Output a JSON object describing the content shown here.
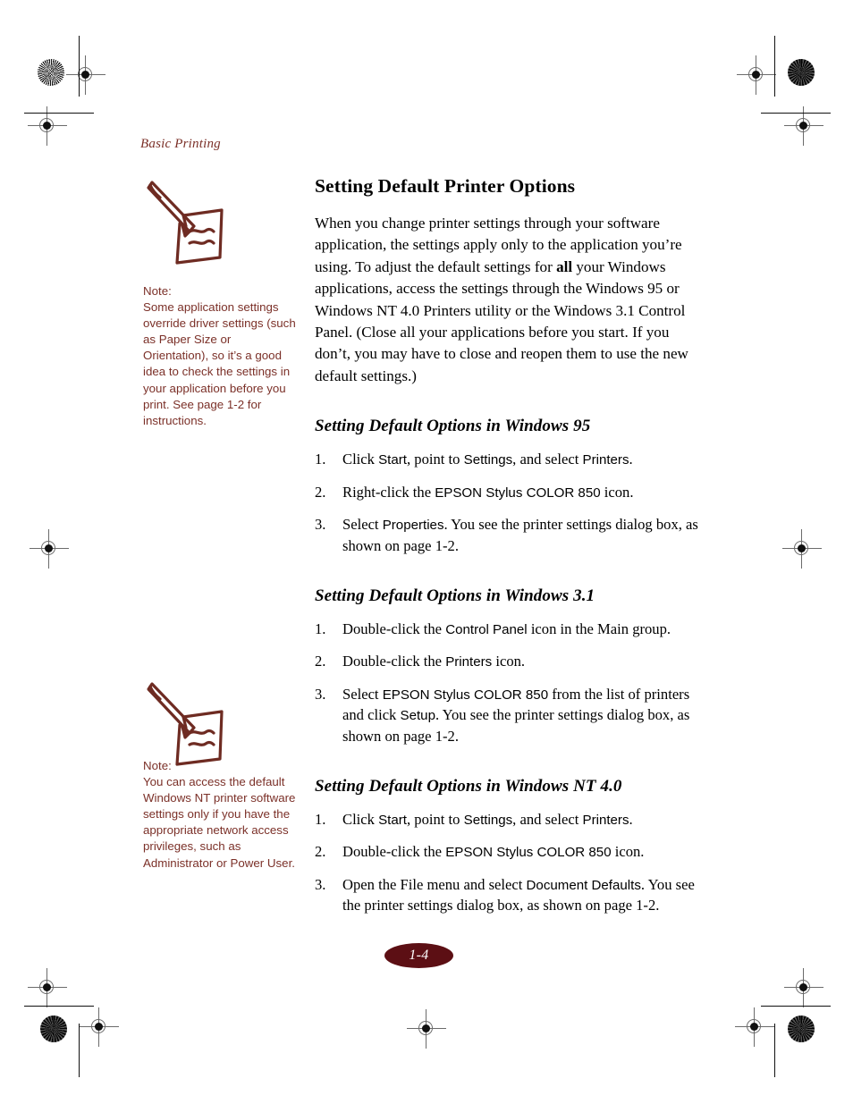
{
  "page": {
    "running_head": "Basic Printing",
    "page_number": "1-4",
    "accent_color": "#7b3028",
    "badge_color": "#5c0f14"
  },
  "notes": [
    {
      "icon": "pencil-note-icon",
      "label": "Note:",
      "text": "Some application settings override driver settings (such as Paper Size or Orientation), so it’s a good idea to check the settings in your application before you print. See page 1-2 for instructions."
    },
    {
      "icon": "pencil-note-icon",
      "label": "Note:",
      "text": "You can access the default Windows NT printer software settings only if you have the appropriate network access privileges, such as Administrator or Power User."
    }
  ],
  "main": {
    "title": "Setting Default Printer Options",
    "intro": {
      "part1": "When you change printer settings through your software application, the settings apply only to the application you’re using. To adjust the default settings for ",
      "emphasis": "all",
      "part2": " your Windows applications, access the settings through the Windows 95 or Windows NT 4.0 Printers utility or the Windows 3.1 Control Panel. (Close all your applications before you start. If you don’t, you may have to close and reopen them to use the new default settings.)"
    },
    "sections": [
      {
        "heading": "Setting Default Options in Windows 95",
        "steps": [
          {
            "num": "1.",
            "frag": [
              {
                "t": "Click ",
                "ui": false
              },
              {
                "t": "Start",
                "ui": true
              },
              {
                "t": ", point to ",
                "ui": false
              },
              {
                "t": "Settings",
                "ui": true
              },
              {
                "t": ", and select ",
                "ui": false
              },
              {
                "t": "Printers",
                "ui": true
              },
              {
                "t": ".",
                "ui": false
              }
            ]
          },
          {
            "num": "2.",
            "frag": [
              {
                "t": "Right-click the ",
                "ui": false
              },
              {
                "t": "EPSON Stylus COLOR 850",
                "ui": true
              },
              {
                "t": " icon.",
                "ui": false
              }
            ]
          },
          {
            "num": "3.",
            "frag": [
              {
                "t": "Select ",
                "ui": false
              },
              {
                "t": "Properties",
                "ui": true
              },
              {
                "t": ". You see the printer settings dialog box, as shown on page 1-2.",
                "ui": false
              }
            ]
          }
        ]
      },
      {
        "heading": "Setting Default Options in Windows 3.1",
        "steps": [
          {
            "num": "1.",
            "frag": [
              {
                "t": "Double-click the ",
                "ui": false
              },
              {
                "t": "Control Panel",
                "ui": true
              },
              {
                "t": " icon in the Main group.",
                "ui": false
              }
            ]
          },
          {
            "num": "2.",
            "frag": [
              {
                "t": "Double-click the ",
                "ui": false
              },
              {
                "t": "Printers",
                "ui": true
              },
              {
                "t": " icon.",
                "ui": false
              }
            ]
          },
          {
            "num": "3.",
            "frag": [
              {
                "t": "Select ",
                "ui": false
              },
              {
                "t": "EPSON Stylus COLOR 850",
                "ui": true
              },
              {
                "t": " from the list of printers and click ",
                "ui": false
              },
              {
                "t": "Setup",
                "ui": true
              },
              {
                "t": ". You see the printer settings dialog box, as shown on page 1-2.",
                "ui": false
              }
            ]
          }
        ]
      },
      {
        "heading": "Setting Default Options in Windows NT 4.0",
        "steps": [
          {
            "num": "1.",
            "frag": [
              {
                "t": "Click ",
                "ui": false
              },
              {
                "t": "Start",
                "ui": true
              },
              {
                "t": ", point to ",
                "ui": false
              },
              {
                "t": "Settings",
                "ui": true
              },
              {
                "t": ", and select ",
                "ui": false
              },
              {
                "t": "Printers",
                "ui": true
              },
              {
                "t": ".",
                "ui": false
              }
            ]
          },
          {
            "num": "2.",
            "frag": [
              {
                "t": "Double-click the ",
                "ui": false
              },
              {
                "t": "EPSON Stylus COLOR 850",
                "ui": true
              },
              {
                "t": " icon.",
                "ui": false
              }
            ]
          },
          {
            "num": "3.",
            "frag": [
              {
                "t": "Open the File menu and select ",
                "ui": false
              },
              {
                "t": "Document Defaults",
                "ui": true
              },
              {
                "t": ". You see the printer settings dialog box, as shown on page 1-2.",
                "ui": false
              }
            ]
          }
        ]
      }
    ]
  }
}
